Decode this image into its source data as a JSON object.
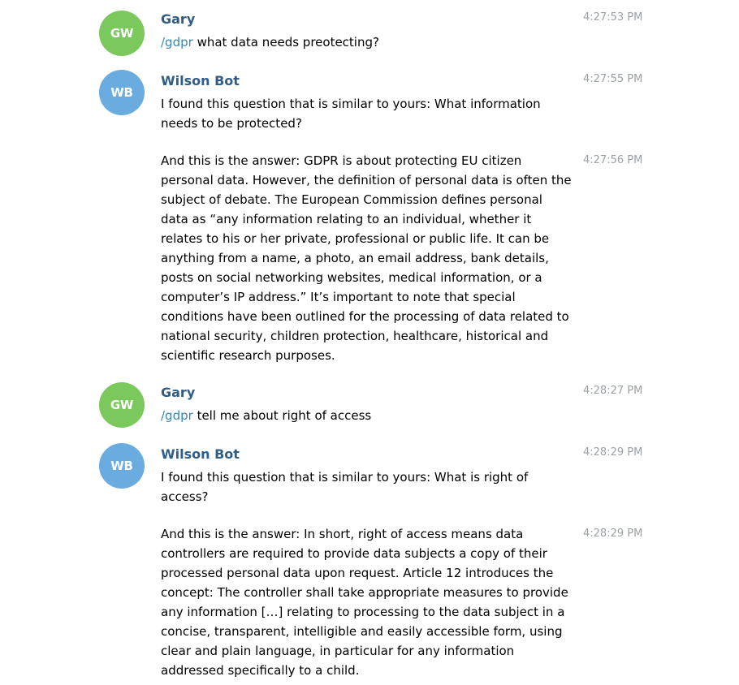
{
  "colors": {
    "gary_avatar": "#7bc85c",
    "bot_avatar": "#6aabe0",
    "sender_name": "#2f5d8a",
    "command_link": "#3a86b8",
    "timestamp": "#9aa0a6"
  },
  "messages": [
    {
      "avatar_initials": "GW",
      "sender": "Gary",
      "time": "4:27:53 PM",
      "command": "/gdpr",
      "text": " what data needs preotecting?"
    },
    {
      "avatar_initials": "WB",
      "sender": "Wilson Bot",
      "time": "4:27:55 PM",
      "text": "I found this question that is similar to yours: What information needs to be protected?"
    },
    {
      "time": "4:27:56 PM",
      "text": "And this is the answer: GDPR is about protecting EU citizen personal data. However, the definition of personal data is often the subject of debate. The European Commission defines personal data as “any information relating to an individual, whether it relates to his or her private, professional or public life. It can be anything from a name, a photo, an email address, bank details, posts on social networking websites, medical information, or a computer’s IP address.” It’s important to note that special conditions have been outlined for the processing of data related to national security, children protection, healthcare, historical and scientific research purposes."
    },
    {
      "avatar_initials": "GW",
      "sender": "Gary",
      "time": "4:28:27 PM",
      "command": "/gdpr",
      "text": " tell me about right of access"
    },
    {
      "avatar_initials": "WB",
      "sender": "Wilson Bot",
      "time": "4:28:29 PM",
      "text": "I found this question that is similar to yours: What is right of access?"
    },
    {
      "time": "4:28:29 PM",
      "text": "And this is the answer: In short, right of access means data controllers are required to provide data subjects a copy of their processed personal data upon request. Article 12 introduces the concept: The controller shall take appropriate measures to provide any information […] relating to processing to the data subject in a concise, transparent, intelligible and easily accessible form, using clear and plain language, in particular for any information addressed specifically to a child."
    }
  ]
}
